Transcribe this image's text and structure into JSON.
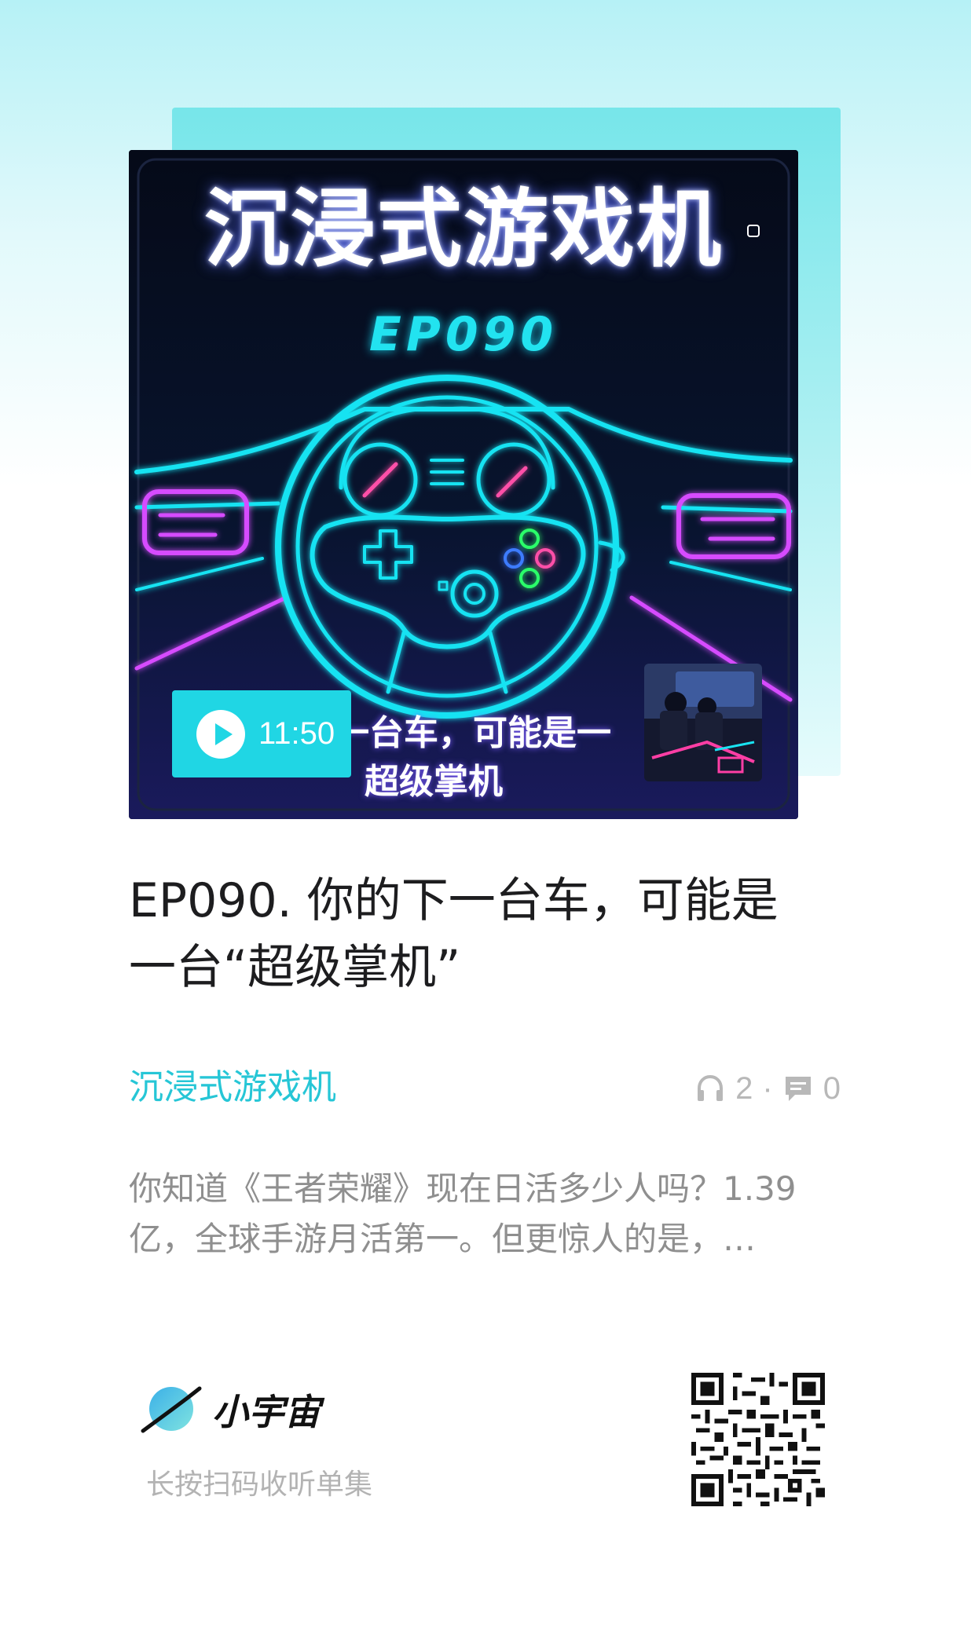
{
  "cover": {
    "title": "沉浸式游戏机",
    "episode_code": "EP090",
    "subtitle_line1": "一台车，可能是一",
    "subtitle_line2": "超级掌机",
    "duration": "11:50"
  },
  "episode": {
    "title": "EP090. 你的下一台车，可能是一台“超级掌机”",
    "podcast_name": "沉浸式游戏机",
    "play_count": "2",
    "stats_separator": "·",
    "comment_count": "0",
    "description": "你知道《王者荣耀》现在日活多少人吗？1.39亿，全球手游月活第一。但更惊人的是，…"
  },
  "footer": {
    "brand_name": "小宇宙",
    "scan_hint": "长按扫码收听单集"
  },
  "colors": {
    "accent": "#26c6d6",
    "play_button": "#20d6e4",
    "neon_cyan": "#19e3f2",
    "neon_pink": "#d64bff"
  },
  "icons": [
    "play-icon",
    "headphones-icon",
    "comment-icon",
    "planet-logo-icon",
    "qr-code"
  ]
}
